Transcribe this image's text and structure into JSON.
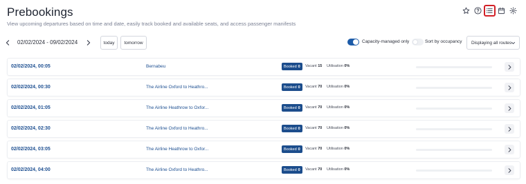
{
  "header": {
    "title": "Prebookings",
    "subtitle": "View upcoming departures based on time and date, easily track booked and available seats, and access passenger manifests"
  },
  "top_icons": [
    {
      "name": "star-icon",
      "active": false
    },
    {
      "name": "help-icon",
      "active": false
    },
    {
      "name": "list-icon",
      "active": true
    },
    {
      "name": "calendar-icon",
      "active": false
    },
    {
      "name": "gear-icon",
      "active": false
    }
  ],
  "controls": {
    "date_range": "02/02/2024 - 09/02/2024",
    "today_label": "today",
    "tomorrow_label": "tomorrow",
    "capacity_label": "Capacity-managed only",
    "capacity_on": true,
    "sort_label": "Sort by occupancy",
    "sort_on": false,
    "routes_select": "Displaying all routes"
  },
  "labels": {
    "booked": "Booked",
    "vacant": "Vacant",
    "utilisation": "Utilisation"
  },
  "rows": [
    {
      "datetime": "02/02/2024, 00:05",
      "route": "Bernabeu",
      "booked": "0",
      "vacant": "15",
      "utilisation": "0%",
      "util_fraction": 0
    },
    {
      "datetime": "02/02/2024, 00:30",
      "route": "The Airline Oxford to Heathro...",
      "booked": "0",
      "vacant": "70",
      "utilisation": "0%",
      "util_fraction": 0
    },
    {
      "datetime": "02/02/2024, 01:05",
      "route": "The Airline Heathrow to Oxfor...",
      "booked": "0",
      "vacant": "70",
      "utilisation": "0%",
      "util_fraction": 0
    },
    {
      "datetime": "02/02/2024, 02:30",
      "route": "The Airline Oxford to Heathro...",
      "booked": "0",
      "vacant": "70",
      "utilisation": "0%",
      "util_fraction": 0
    },
    {
      "datetime": "02/02/2024, 03:05",
      "route": "The Airline Heathrow to Oxfor...",
      "booked": "0",
      "vacant": "70",
      "utilisation": "0%",
      "util_fraction": 0
    },
    {
      "datetime": "02/02/2024, 04:00",
      "route": "The Airline Oxford to Heathro...",
      "booked": "0",
      "vacant": "70",
      "utilisation": "0%",
      "util_fraction": 0
    }
  ],
  "colors": {
    "accent": "#1c4d8c",
    "link": "#1d4f91",
    "active_outline": "#d21f26"
  }
}
